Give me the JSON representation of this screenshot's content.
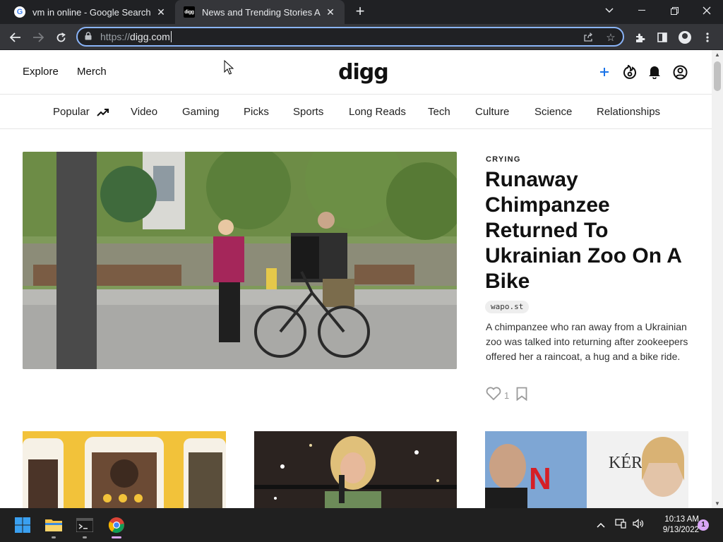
{
  "browser": {
    "tabs": [
      {
        "title": "vm in online - Google Search",
        "favicon": "google-icon",
        "active": false
      },
      {
        "title": "News and Trending Stories Aroun",
        "favicon": "digg-favicon",
        "active": true
      }
    ],
    "new_tab_symbol": "+",
    "url_scheme": "https://",
    "url_host": "digg.com",
    "colors": {
      "tabbar": "#202124",
      "toolbar": "#35363a",
      "focus_ring": "#8ab4f8"
    }
  },
  "site": {
    "header": {
      "links": [
        "Explore",
        "Merch"
      ],
      "logo": "digg"
    },
    "categories": [
      "Popular",
      "Video",
      "Gaming",
      "Picks",
      "Sports",
      "Long Reads",
      "Tech",
      "Culture",
      "Science",
      "Relationships"
    ],
    "featured": {
      "kicker": "CRYING",
      "headline": "Runaway Chimpanzee Returned To Ukrainian Zoo On A Bike",
      "source": "wapo.st",
      "description": "A chimpanzee who ran away from a Ukrainian zoo was talked into returning after zookeepers offered her a raincoat, a hug and a bike ride.",
      "likes": "1"
    },
    "cards": [
      {
        "image": "phone-screens-photo"
      },
      {
        "image": "awards-show-photo"
      },
      {
        "image": "celebrity-portraits-photo"
      }
    ],
    "accent_color": "#1a73e8"
  },
  "taskbar": {
    "apps": [
      "windows-start-icon",
      "file-explorer-icon",
      "terminal-icon",
      "chrome-icon"
    ],
    "time": "10:13 AM",
    "date": "9/13/2022",
    "notification_count": "1"
  }
}
